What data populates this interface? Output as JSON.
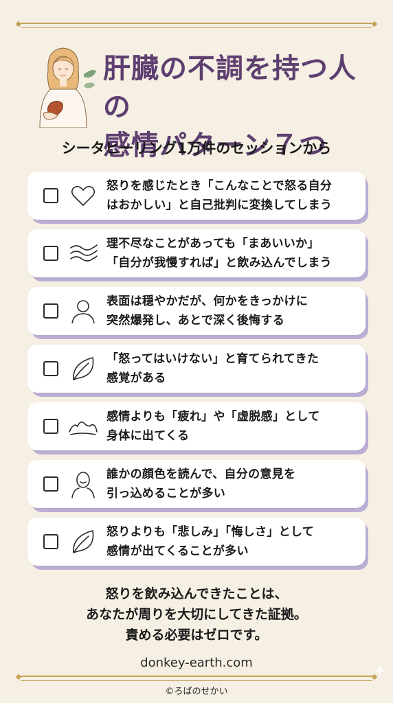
{
  "title": {
    "line1": "肝臓の不調を持つ人の",
    "line2": "感情パターン７つ"
  },
  "subtitle": "シータヒーリング1万件のセッションから",
  "items": [
    {
      "icon": "heart-icon",
      "text": "怒りを感じたとき「こんなことで怒る自分\nはおかしい」と自己批判に変換してしまう"
    },
    {
      "icon": "wave-icon",
      "text": "理不尽なことがあっても「まあいいか」\n「自分が我慢すれば」と飲み込んでしまう"
    },
    {
      "icon": "person-icon",
      "text": "表面は穏やかだが、何かをきっかけに\n突然爆発し、あとで深く後悔する"
    },
    {
      "icon": "leaf-icon",
      "text": "「怒ってはいけない」と育てられてきた\n感覚がある"
    },
    {
      "icon": "fatigue-wave-icon",
      "text": "感情よりも「疲れ」や「虚脱感」として\n身体に出てくる"
    },
    {
      "icon": "face-icon",
      "text": "誰かの顔色を読んで、自分の意見を\n引っ込めることが多い"
    },
    {
      "icon": "leaf-icon",
      "text": "怒りよりも「悲しみ」「悔しさ」として\n感情が出てくることが多い"
    }
  ],
  "closing": "怒りを飲み込んできたことは、\nあなたが周りを大切にしてきた証拠。\n責める必要はゼロです。",
  "site": "donkey-earth.com",
  "copyright": "©ろばのせかい",
  "colors": {
    "background": "#f6efe3",
    "title": "#5d3f70",
    "card_shadow": "#bbaed4",
    "rule": "#c6a25a"
  }
}
